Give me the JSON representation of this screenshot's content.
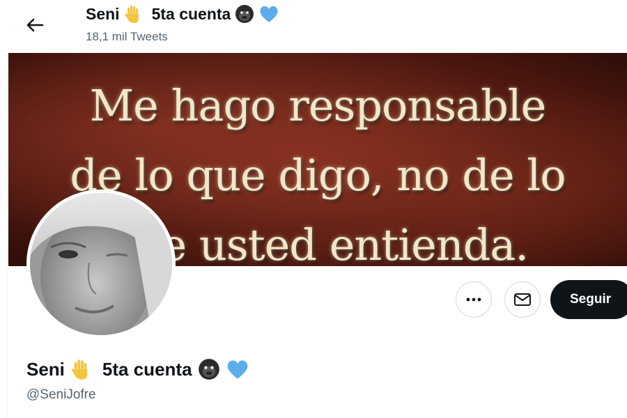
{
  "header": {
    "display_name": "Seni",
    "name_suffix": "5ta cuenta",
    "tweet_count": "18,1 mil Tweets"
  },
  "banner": {
    "lines": [
      "Me hago responsable",
      "de lo que digo, no de lo",
      "que usted entienda."
    ]
  },
  "profile": {
    "display_name": "Seni",
    "name_suffix": "5ta cuenta",
    "handle": "@SeniJofre"
  },
  "actions": {
    "follow_label": "Seguir"
  },
  "icons": {
    "back": "arrow-left-icon",
    "more": "ellipsis-icon",
    "message": "envelope-icon",
    "emoji_hand": "raised-hand-emoji",
    "emoji_gorilla": "gorilla-emoji",
    "emoji_heart": "blue-heart-emoji"
  },
  "colors": {
    "text": "#0f1419",
    "muted": "#536471",
    "heart": "#5dadec",
    "hand": "#f5c542",
    "follow_bg": "#0f1419"
  }
}
